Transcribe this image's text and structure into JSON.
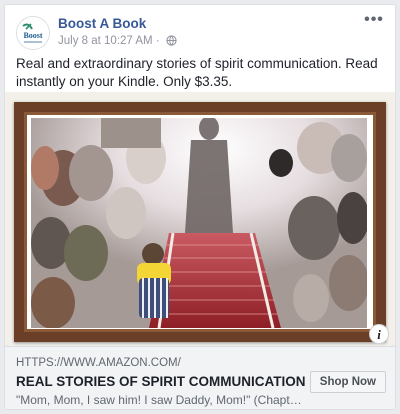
{
  "post": {
    "page_name": "Boost A Book",
    "timestamp": "July 8 at 10:27 AM",
    "separator": " · ",
    "privacy_icon": "globe-icon",
    "more_icon_label": "•••",
    "text": "Real and extraordinary stories of spirit communication. Read instantly on your Kindle. Only $3.35.",
    "avatar_logo_text": "Boost"
  },
  "link": {
    "domain": "HTTPS://WWW.AMAZON.COM/",
    "headline": "REAL STORIES OF SPIRIT COMMUNICATION",
    "description": "\"Mom, Mom, I saw him! I saw Daddy, Mom!\" (Chapter...",
    "cta_label": "Shop Now",
    "info_label": "i"
  },
  "colors": {
    "page_name": "#385898",
    "frame": "#6b3f27",
    "staircase": "#b5373c",
    "footer_bg": "#f2f3f5"
  }
}
